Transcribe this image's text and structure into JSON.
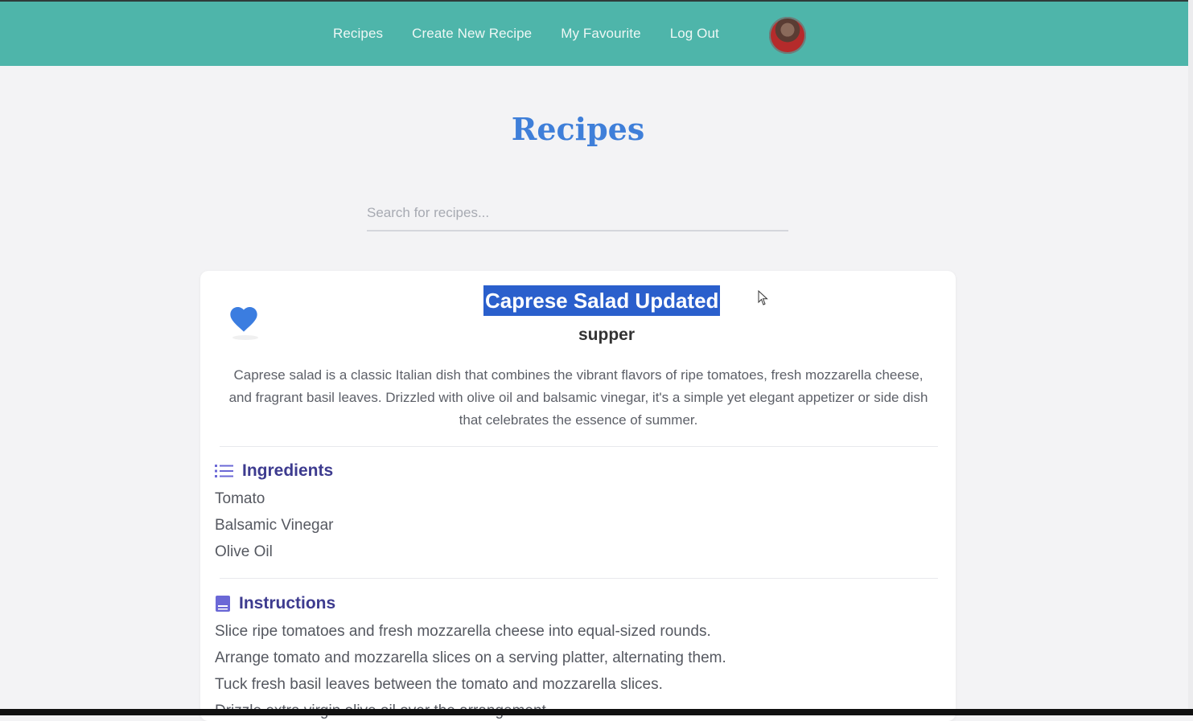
{
  "nav": {
    "items": [
      "Recipes",
      "Create New Recipe",
      "My Favourite",
      "Log Out"
    ]
  },
  "page": {
    "title": "Recipes",
    "search_placeholder": "Search for recipes..."
  },
  "recipe": {
    "title": "Caprese Salad Updated",
    "category": "supper",
    "description": "Caprese salad is a classic Italian dish that combines the vibrant flavors of ripe tomatoes, fresh mozzarella cheese, and fragrant basil leaves. Drizzled with olive oil and balsamic vinegar, it's a simple yet elegant appetizer or side dish that celebrates the essence of summer.",
    "favourite": true,
    "ingredients_label": "Ingredients",
    "ingredients": [
      "Tomato",
      "Balsamic Vinegar",
      "Olive Oil"
    ],
    "instructions_label": "Instructions",
    "instructions": [
      "Slice ripe tomatoes and fresh mozzarella cheese into equal-sized rounds.",
      "Arrange tomato and mozzarella slices on a serving platter, alternating them.",
      "Tuck fresh basil leaves between the tomato and mozzarella slices.",
      "Drizzle extra virgin olive oil over the arrangement."
    ]
  },
  "colors": {
    "header": "#4eb5aa",
    "title": "#3f7fd9",
    "heart": "#3b7de0",
    "section": "#3d3b8f",
    "selection": "#2a5fcc"
  },
  "icons": {
    "heart": "heart-icon",
    "ingredients": "list-icon",
    "instructions": "book-icon",
    "cursor": "mouse-pointer-icon"
  }
}
